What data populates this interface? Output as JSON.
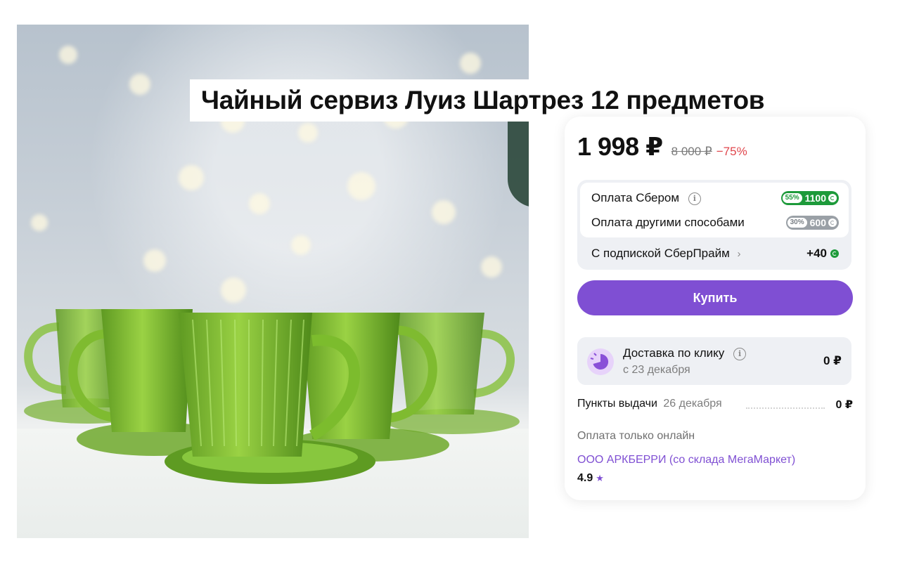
{
  "product": {
    "title": "Чайный сервиз Луиз Шартрез 12 предметов",
    "image_icon": "green-glass-teacups-photo"
  },
  "pricing": {
    "price": "1 998 ₽",
    "old_price": "8 000 ₽",
    "discount": "−75%"
  },
  "bonuses": {
    "sber": {
      "label": "Оплата Сбером",
      "percent": "55%",
      "amount": "1100"
    },
    "other": {
      "label": "Оплата другими способами",
      "percent": "30%",
      "amount": "600"
    },
    "prime": {
      "label": "С подпиской СберПрайм",
      "value": "+40"
    }
  },
  "actions": {
    "buy_label": "Купить"
  },
  "delivery": {
    "title": "Доставка по клику",
    "date": "с 23 декабря",
    "price": "0 ₽"
  },
  "pickup": {
    "label": "Пункты выдачи",
    "date": "26 декабря",
    "price": "0 ₽"
  },
  "payment_note": "Оплата только онлайн",
  "seller": {
    "name": "ООО АРКБЕРРИ (со склада МегаМаркет)",
    "rating": "4.9"
  },
  "colors": {
    "accent": "#7f4fd3",
    "bonus_green": "#1d9a3a",
    "discount_red": "#e0464c"
  }
}
